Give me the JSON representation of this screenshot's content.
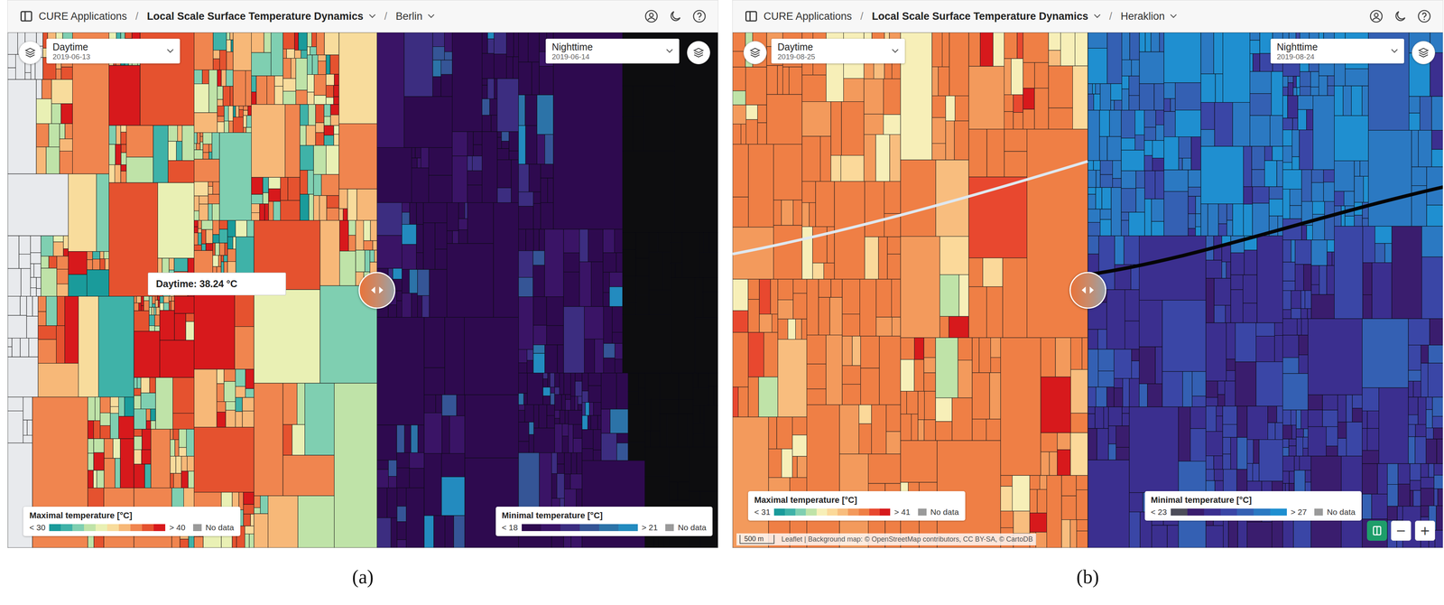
{
  "panels": [
    {
      "label": "(a)",
      "header": {
        "app": "CURE Applications",
        "separator": "/",
        "product": "Local Scale Surface Temperature Dynamics",
        "city": "Berlin"
      },
      "day": {
        "title": "Daytime",
        "date": "2019-06-13",
        "legend": {
          "title": "Maximal temperature [°C]",
          "min": "< 30",
          "max": "> 40",
          "no_data": "No data",
          "bins": [
            "#1a9b9b",
            "#3fb2a8",
            "#7fcfb1",
            "#bfe3a8",
            "#e9f0b4",
            "#f8dc9c",
            "#f7b878",
            "#f0854f",
            "#e5522f",
            "#d7191c"
          ]
        }
      },
      "night": {
        "title": "Nighttime",
        "date": "2019-06-14",
        "legend": {
          "title": "Minimal temperature [°C]",
          "min": "< 18",
          "max": "> 21",
          "no_data": "No data",
          "bins": [
            "#2e0a4f",
            "#3a1466",
            "#3c2d80",
            "#355596",
            "#2c73a8",
            "#238bbf"
          ]
        }
      },
      "tooltip": "Daytime: 38.24 °C",
      "scale": null,
      "attribution": null,
      "zoom": null
    },
    {
      "label": "(b)",
      "header": {
        "app": "CURE Applications",
        "separator": "/",
        "product": "Local Scale Surface Temperature Dynamics",
        "city": "Heraklion"
      },
      "day": {
        "title": "Daytime",
        "date": "2019-08-25",
        "legend": {
          "title": "Maximal temperature [°C]",
          "min": "< 31",
          "max": "> 41",
          "no_data": "No data",
          "bins": [
            "#1a9b9b",
            "#3fb2a8",
            "#7fcfb1",
            "#bfe3a8",
            "#f7efb8",
            "#fbd99a",
            "#f8bd7e",
            "#f39a5c",
            "#ef7f45",
            "#e8482f",
            "#d7191c"
          ]
        }
      },
      "night": {
        "title": "Nighttime",
        "date": "2019-08-24",
        "legend": {
          "title": "Minimal temperature [°C]",
          "min": "< 23",
          "max": "> 27",
          "no_data": "No data",
          "bins": [
            "#4d4d5a",
            "#3a1d6e",
            "#3b2f8f",
            "#3a46a6",
            "#3460b3",
            "#2b79c2",
            "#1f8fd0"
          ]
        }
      },
      "tooltip": null,
      "scale": "500 m",
      "attribution": "Leaflet | Background map: © OpenStreetMap contributors, CC BY-SA, © CartoDB",
      "zoom": [
        "−",
        "+"
      ]
    }
  ]
}
